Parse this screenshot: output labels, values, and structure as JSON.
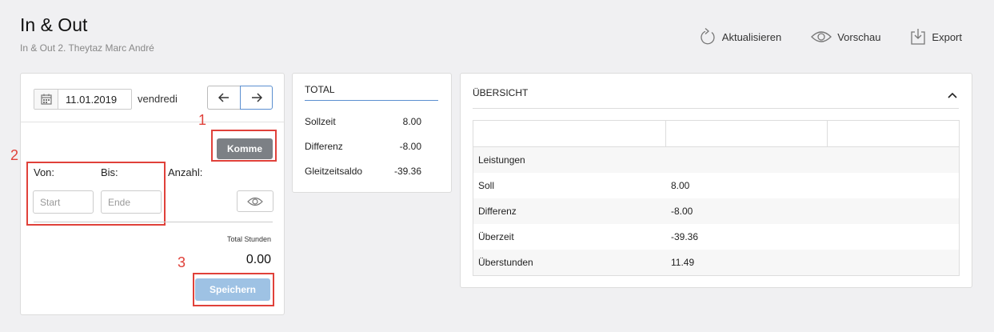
{
  "header": {
    "title": "In & Out",
    "subtitle": "In & Out 2. Theytaz Marc André"
  },
  "toolbar": {
    "refresh_label": "Aktualisieren",
    "preview_label": "Vorschau",
    "export_label": "Export"
  },
  "entry": {
    "date": "11.01.2019",
    "weekday": "vendredi",
    "komme_label": "Komme",
    "von_label": "Von:",
    "bis_label": "Bis:",
    "anzahl_label": "Anzahl:",
    "start_placeholder": "Start",
    "end_placeholder": "Ende",
    "total_hours_label": "Total Stunden",
    "total_hours_value": "0.00",
    "save_label": "Speichern"
  },
  "annotations": [
    "1",
    "2",
    "3"
  ],
  "total": {
    "title": "TOTAL",
    "rows": [
      {
        "label": "Sollzeit",
        "value": "8.00"
      },
      {
        "label": "Differenz",
        "value": "-8.00"
      },
      {
        "label": "Gleitzeitsaldo",
        "value": "-39.36"
      }
    ]
  },
  "overview": {
    "title": "ÜBERSICHT",
    "rows": [
      {
        "label": "Leistungen",
        "value": ""
      },
      {
        "label": "Soll",
        "value": "8.00"
      },
      {
        "label": "Differenz",
        "value": "-8.00"
      },
      {
        "label": "Überzeit",
        "value": "-39.36"
      },
      {
        "label": "Überstunden",
        "value": "11.49"
      }
    ]
  },
  "colors": {
    "accent": "#5b8fd0",
    "annotation": "#e0413a",
    "komme_button": "#7c8085",
    "save_button": "#9ec2e4"
  }
}
